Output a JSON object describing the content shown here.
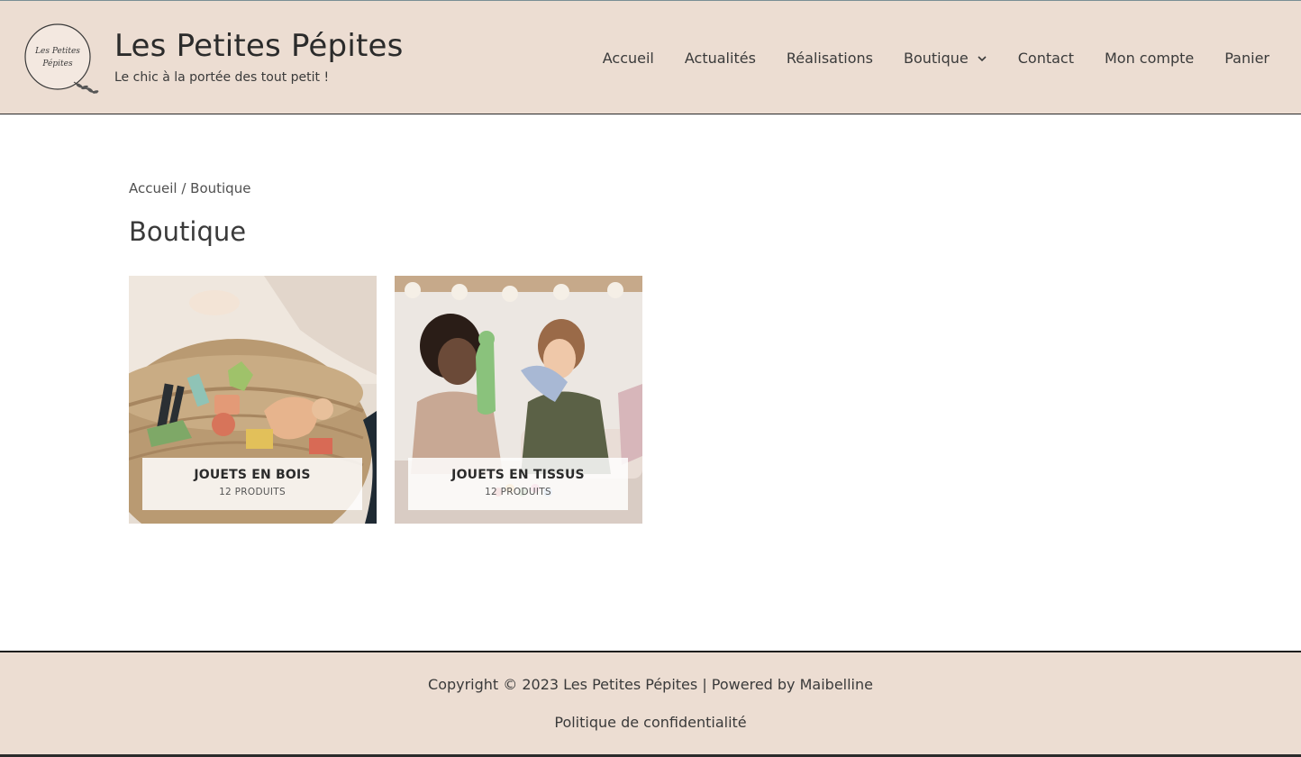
{
  "header": {
    "logo_text_line1": "Les Petites",
    "logo_text_line2": "Pépites",
    "site_title": "Les Petites Pépites",
    "tagline": "Le chic à la portée des tout petit !"
  },
  "nav": {
    "items": [
      {
        "label": "Accueil"
      },
      {
        "label": "Actualités"
      },
      {
        "label": "Réalisations"
      },
      {
        "label": "Boutique",
        "has_dropdown": true
      },
      {
        "label": "Contact"
      },
      {
        "label": "Mon compte"
      },
      {
        "label": "Panier"
      }
    ]
  },
  "breadcrumb": {
    "home": "Accueil",
    "separator": " / ",
    "current": "Boutique"
  },
  "page": {
    "title": "Boutique"
  },
  "categories": [
    {
      "name": "JOUETS EN BOIS",
      "count": "12 PRODUITS"
    },
    {
      "name": "JOUETS EN TISSUS",
      "count": "12 PRODUITS"
    }
  ],
  "footer": {
    "copyright": "Copyright © 2023 Les Petites Pépites | Powered by Maibelline",
    "privacy_link": "Politique de confidentialité"
  },
  "colors": {
    "header_bg": "#ecddd2",
    "footer_bg": "#ecddd2",
    "text": "#3a3a3a"
  }
}
